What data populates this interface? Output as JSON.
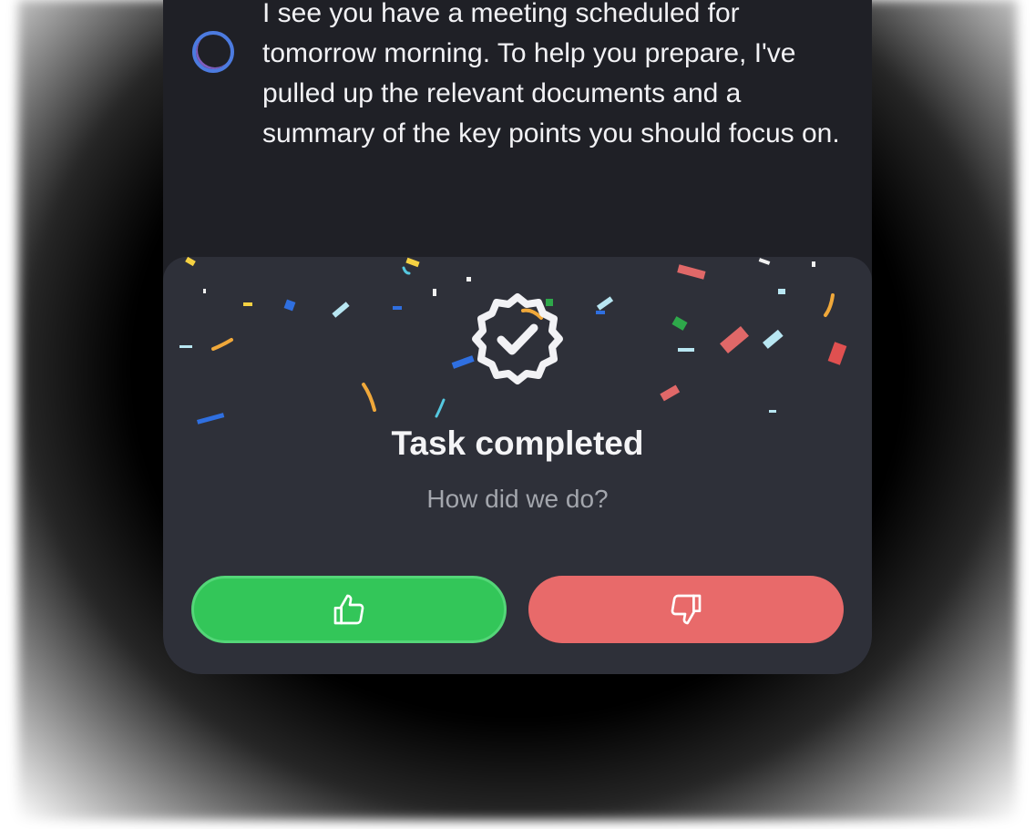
{
  "message": {
    "text": "I see you have a meeting scheduled for tomorrow morning. To help you prepare, I've pulled up the relevant documents and a summary of the key points you should focus on."
  },
  "completion_card": {
    "title": "Task completed",
    "subtitle": "How did we do?",
    "badge_icon": "verified-badge-check-icon"
  },
  "feedback": {
    "positive_icon": "thumbs-up-icon",
    "negative_icon": "thumbs-down-icon"
  },
  "colors": {
    "app_background": "#1f2026",
    "card_background": "#2e3039",
    "positive_button": "#33c659",
    "negative_button": "#e86a6a",
    "text_primary": "#f4f4f6",
    "text_secondary": "#a3a6ad"
  }
}
